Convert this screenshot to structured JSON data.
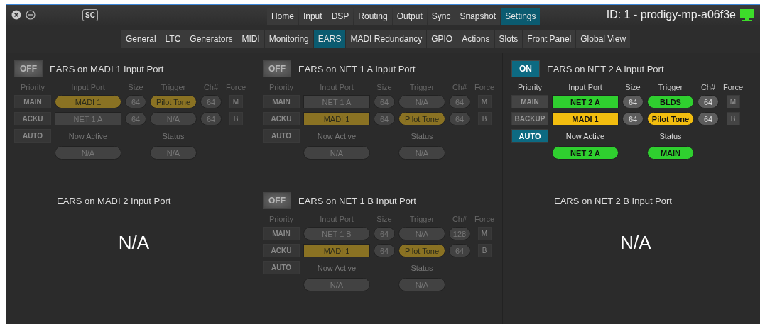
{
  "title_bar": {
    "logo": "SC",
    "tabs": [
      {
        "label": "Home",
        "selected": false
      },
      {
        "label": "Input",
        "selected": false
      },
      {
        "label": "DSP",
        "selected": false
      },
      {
        "label": "Routing",
        "selected": false
      },
      {
        "label": "Output",
        "selected": false
      },
      {
        "label": "Sync",
        "selected": false
      },
      {
        "label": "Snapshot",
        "selected": false
      },
      {
        "label": "Settings",
        "selected": true
      }
    ],
    "device_id": "ID: 1 - prodigy-mp-a06f3e"
  },
  "sub_tabs": [
    {
      "label": "General",
      "selected": false
    },
    {
      "label": "LTC",
      "selected": false
    },
    {
      "label": "Generators",
      "selected": false
    },
    {
      "label": "MIDI",
      "selected": false
    },
    {
      "label": "Monitoring",
      "selected": false
    },
    {
      "label": "EARS",
      "selected": true
    },
    {
      "label": "MADI Redundancy",
      "selected": false
    },
    {
      "label": "GPIO",
      "selected": false
    },
    {
      "label": "Actions",
      "selected": false
    },
    {
      "label": "Slots",
      "selected": false
    },
    {
      "label": "Front Panel",
      "selected": false
    },
    {
      "label": "Global View",
      "selected": false
    }
  ],
  "panels": [
    {
      "kind": "ears",
      "title": "EARS on MADI 1 Input Port",
      "toggle": {
        "label": "OFF",
        "on": false
      },
      "headers": [
        "Priority",
        "Input Port",
        "Size",
        "Trigger",
        "Ch#",
        "Force"
      ],
      "priority": [
        {
          "label": "MAIN",
          "selected": false
        },
        {
          "label": "ACKU",
          "selected": false
        },
        {
          "label": "AUTO",
          "selected": false
        }
      ],
      "rows": [
        {
          "port": {
            "text": "MADI 1",
            "kind": "pill",
            "color": "#8a7223"
          },
          "size": "64",
          "trigger": {
            "text": "Pilot Tone",
            "color": "#8a7223"
          },
          "ch": "64",
          "force": "M"
        },
        {
          "port": {
            "text": "NET 1 A",
            "kind": "rect"
          },
          "size": "64",
          "trigger": {
            "text": "N/A"
          },
          "ch": "64",
          "force": "B"
        }
      ],
      "now_active_label": "Now Active",
      "now_active": {
        "text": "N/A"
      },
      "status_label": "Status",
      "status": {
        "text": "N/A"
      }
    },
    {
      "kind": "ears",
      "title": "EARS on NET 1 A Input Port",
      "toggle": {
        "label": "OFF",
        "on": false
      },
      "headers": [
        "Priority",
        "Input Port",
        "Size",
        "Trigger",
        "Ch#",
        "Force"
      ],
      "priority": [
        {
          "label": "MAIN",
          "selected": false
        },
        {
          "label": "ACKU",
          "selected": false
        },
        {
          "label": "AUTO",
          "selected": false
        }
      ],
      "rows": [
        {
          "port": {
            "text": "NET 1 A",
            "kind": "rect"
          },
          "size": "64",
          "trigger": {
            "text": "N/A"
          },
          "ch": "64",
          "force": "M"
        },
        {
          "port": {
            "text": "MADI 1",
            "kind": "rect",
            "color": "#8a7223"
          },
          "size": "64",
          "trigger": {
            "text": "Pilot Tone",
            "color": "#8a7223"
          },
          "ch": "64",
          "force": "B"
        }
      ],
      "now_active_label": "Now Active",
      "now_active": {
        "text": "N/A"
      },
      "status_label": "Status",
      "status": {
        "text": "N/A"
      }
    },
    {
      "kind": "ears",
      "title": "EARS on NET 2 A Input Port",
      "toggle": {
        "label": "ON",
        "on": true
      },
      "headers": [
        "Priority",
        "Input Port",
        "Size",
        "Trigger",
        "Ch#",
        "Force"
      ],
      "priority": [
        {
          "label": "MAIN",
          "selected": false
        },
        {
          "label": "BACKUP",
          "selected": false
        },
        {
          "label": "AUTO",
          "selected": true
        }
      ],
      "rows": [
        {
          "port": {
            "text": "NET 2 A",
            "kind": "rect",
            "color": "#2fcf2f"
          },
          "size": "64",
          "trigger": {
            "text": "BLDS",
            "color": "#2fcf2f"
          },
          "ch": "64",
          "force": "M"
        },
        {
          "port": {
            "text": "MADI 1",
            "kind": "rect",
            "color": "#f2bd0f"
          },
          "size": "64",
          "trigger": {
            "text": "Pilot Tone",
            "color": "#f2bd0f"
          },
          "ch": "64",
          "force": "B"
        }
      ],
      "now_active_label": "Now Active",
      "now_active": {
        "text": "NET 2 A",
        "color": "#2fcf2f"
      },
      "status_label": "Status",
      "status": {
        "text": "MAIN",
        "color": "#2fcf2f"
      }
    },
    {
      "kind": "na",
      "title": "EARS on MADI 2 Input Port",
      "message": "N/A"
    },
    {
      "kind": "ears",
      "title": "EARS on NET 1 B Input Port",
      "toggle": {
        "label": "OFF",
        "on": false
      },
      "headers": [
        "Priority",
        "Input Port",
        "Size",
        "Trigger",
        "Ch#",
        "Force"
      ],
      "priority": [
        {
          "label": "MAIN",
          "selected": false
        },
        {
          "label": "ACKU",
          "selected": false
        },
        {
          "label": "AUTO",
          "selected": false
        }
      ],
      "rows": [
        {
          "port": {
            "text": "NET 1 B",
            "kind": "pill"
          },
          "size": "64",
          "trigger": {
            "text": "N/A"
          },
          "ch": "128",
          "force": "M"
        },
        {
          "port": {
            "text": "MADI 1",
            "kind": "rect",
            "color": "#8a7223"
          },
          "size": "64",
          "trigger": {
            "text": "Pilot Tone",
            "color": "#8a7223"
          },
          "ch": "64",
          "force": "B"
        }
      ],
      "now_active_label": "Now Active",
      "now_active": {
        "text": "N/A"
      },
      "status_label": "Status",
      "status": {
        "text": "N/A"
      }
    },
    {
      "kind": "na",
      "title": "EARS on NET 2 B Input Port",
      "message": "N/A"
    }
  ]
}
